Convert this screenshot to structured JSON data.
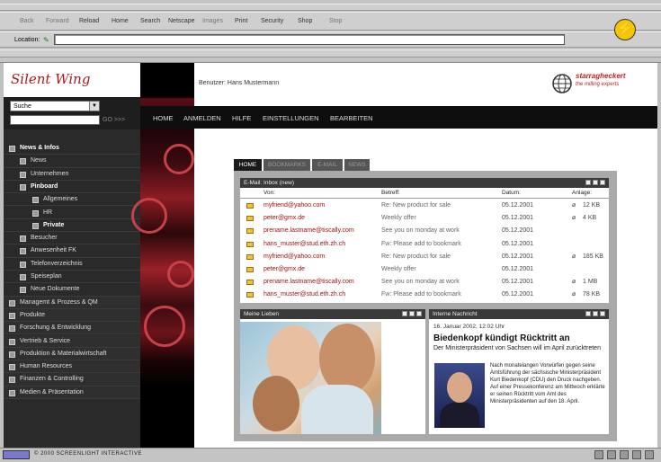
{
  "browser": {
    "buttons": [
      {
        "label": "Back",
        "dim": true
      },
      {
        "label": "Forward",
        "dim": true
      },
      {
        "label": "Reload",
        "dim": false
      },
      {
        "label": "Home",
        "dim": false
      },
      {
        "label": "Search",
        "dim": false
      },
      {
        "label": "Netscape",
        "dim": false
      },
      {
        "label": "Images",
        "dim": true
      },
      {
        "label": "Print",
        "dim": false
      },
      {
        "label": "Security",
        "dim": false
      },
      {
        "label": "Shop",
        "dim": false
      },
      {
        "label": "Stop",
        "dim": true
      }
    ],
    "location_label": "Location:",
    "location_value": "",
    "status_text": "© 2000 SCREENLIGHT INTERACTIVE"
  },
  "logo": "Silent Wing",
  "search": {
    "selected": "Suche",
    "go": "GO >>>"
  },
  "user_label": "Benutzer: Hans Mustermann",
  "brand": {
    "name": "starragheckert",
    "tagline": "the milling experts"
  },
  "topnav": [
    "HOME",
    "ANMELDEN",
    "HILFE",
    "EINSTELLUNGEN",
    "BEARBEITEN"
  ],
  "sidebar": [
    {
      "label": "News & Infos",
      "level": 0,
      "bold": true
    },
    {
      "label": "News",
      "level": 1
    },
    {
      "label": "Unternehmen",
      "level": 1
    },
    {
      "label": "Pinboard",
      "level": 1,
      "bold": true
    },
    {
      "label": "Allgemeines",
      "level": 2
    },
    {
      "label": "HR",
      "level": 2
    },
    {
      "label": "Private",
      "level": 2,
      "bold": true
    },
    {
      "label": "Besucher",
      "level": 1
    },
    {
      "label": "Anwesenheit FK",
      "level": 1
    },
    {
      "label": "Telefonverzeichnis",
      "level": 1
    },
    {
      "label": "Speiseplan",
      "level": 1
    },
    {
      "label": "Neue Dokumente",
      "level": 1
    },
    {
      "label": "Managemt & Prozess & QM",
      "level": 0
    },
    {
      "label": "Produkte",
      "level": 0
    },
    {
      "label": "Forschung & Entwicklung",
      "level": 0
    },
    {
      "label": "Vertrieb & Service",
      "level": 0
    },
    {
      "label": "Produktion & Materialwirtschaft",
      "level": 0
    },
    {
      "label": "Human Resources",
      "level": 0
    },
    {
      "label": "Finanzen & Controlling",
      "level": 0
    },
    {
      "label": "Medien & Präsentation",
      "level": 0
    }
  ],
  "tabs": [
    {
      "label": "HOME",
      "active": true
    },
    {
      "label": "BOOKMARKS",
      "active": false
    },
    {
      "label": "E-MAIL",
      "active": false
    },
    {
      "label": "NEWS",
      "active": false
    }
  ],
  "inbox": {
    "title": "E-Mail: Inbox (new)",
    "columns": {
      "from": "Von:",
      "subject": "Betreff:",
      "date": "Datum:",
      "attachment": "Anlage:"
    },
    "rows": [
      {
        "from": "myfriend@yahoo.com",
        "subject": "Re: New product for sale",
        "date": "05.12.2001",
        "attach": true,
        "size": "12 KB"
      },
      {
        "from": "peter@gmx.de",
        "subject": "Weekly offer",
        "date": "05.12.2001",
        "attach": true,
        "size": "4 KB"
      },
      {
        "from": "prename.lastname@tiscally.com",
        "subject": "See you on monday at work",
        "date": "05.12.2001",
        "attach": false,
        "size": ""
      },
      {
        "from": "hans_muster@stud.eth.zh.ch",
        "subject": "Fw: Please add to bookmark",
        "date": "05.12.2001",
        "attach": false,
        "size": ""
      },
      {
        "from": "myfriend@yahoo.com",
        "subject": "Re: New product for sale",
        "date": "05.12.2001",
        "attach": true,
        "size": "185 KB"
      },
      {
        "from": "peter@gmx.de",
        "subject": "Weekly offer",
        "date": "05.12.2001",
        "attach": false,
        "size": ""
      },
      {
        "from": "prename.lastname@tiscally.com",
        "subject": "See you on monday at work",
        "date": "05.12.2001",
        "attach": true,
        "size": "1 MB"
      },
      {
        "from": "hans_muster@stud.eth.zh.ch",
        "subject": "Fw: Please add to bookmark",
        "date": "05.12.2001",
        "attach": true,
        "size": "78 KB"
      }
    ]
  },
  "lieben": {
    "title": "Meine Lieben"
  },
  "news": {
    "title": "Interne Nachricht",
    "date": "16. Januar 2002, 12:02 Uhr",
    "headline": "Biedenkopf kündigt Rücktritt an",
    "lead": "Der Ministerpräsident von Sachsen will im April zurücktreten",
    "body": "Nach monatelangen Vorwürfen gegen seine Amtsführung der sächsische Ministerpräsident Kurt Biedenkopf (CDU) den Druck nachgeben. Auf einer Pressekonferenz am Mittwoch erklärte er seinen Rücktritt vom Amt des Ministerpräsidenten auf den 18. April."
  }
}
